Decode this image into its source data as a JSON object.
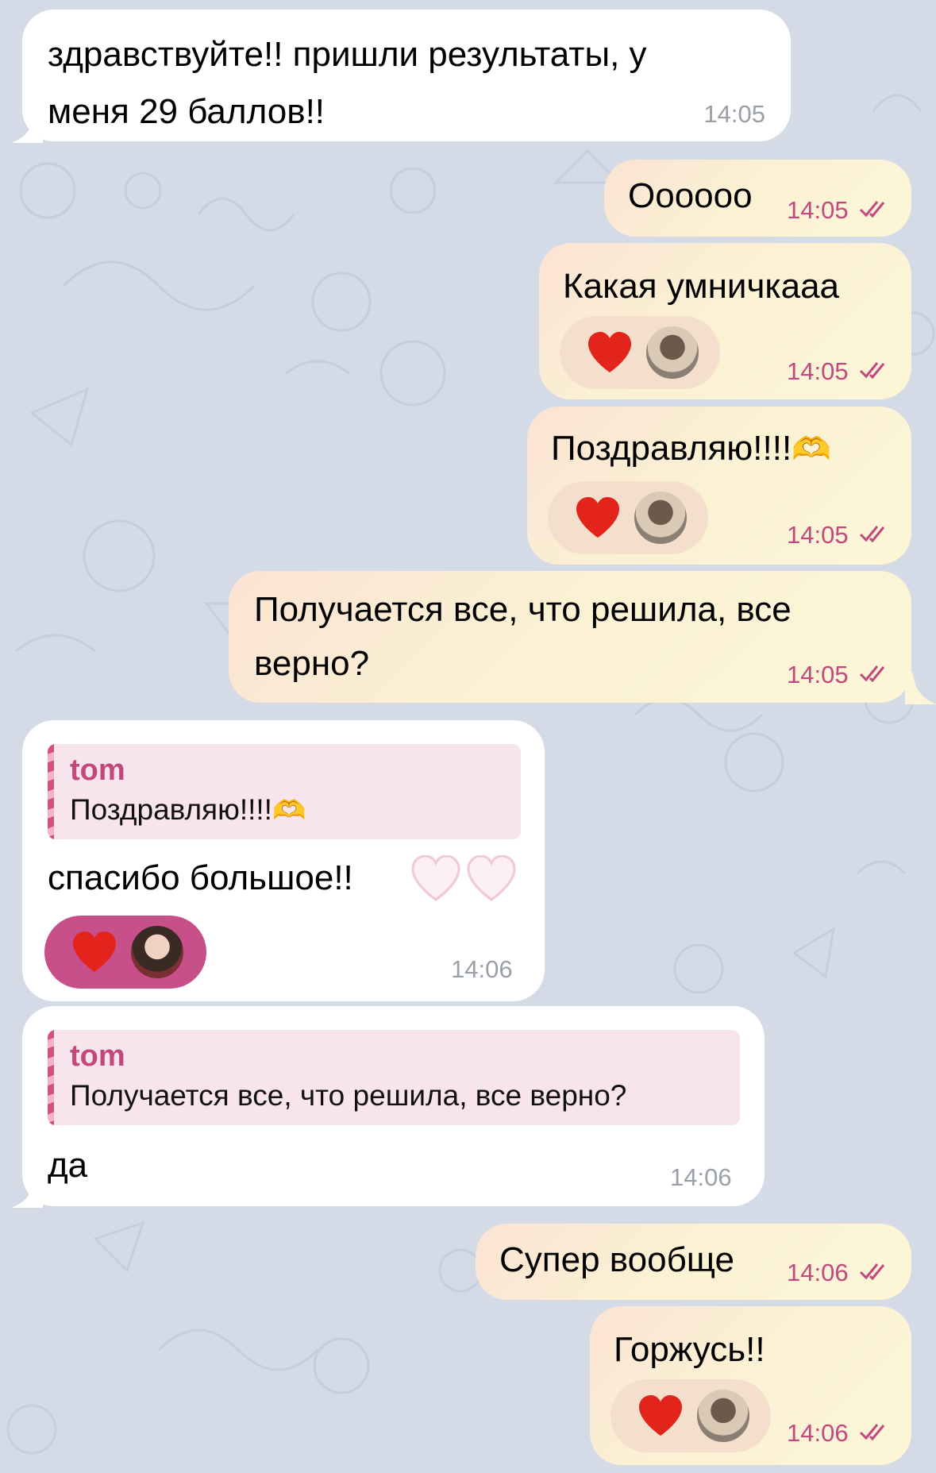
{
  "messages": {
    "m1": {
      "text1": "здравствуйте!! пришли результаты, у",
      "text2": "меня 29 баллов!!",
      "time": "14:05"
    },
    "m2": {
      "text": "Оооооо",
      "time": "14:05"
    },
    "m3": {
      "text": "Какая умничкааа",
      "time": "14:05",
      "reaction": "❤️"
    },
    "m4": {
      "text": "Поздравляю!!!!",
      "emoji": "🫶",
      "time": "14:05",
      "reaction": "❤️"
    },
    "m5": {
      "text1": "Получается все, что решила, все",
      "text2": "верно?",
      "time": "14:05"
    },
    "m6": {
      "reply_name": "tom",
      "reply_text": "Поздравляю!!!!",
      "reply_emoji": "🫶",
      "text": "спасибо большое!!",
      "time": "14:06",
      "reaction": "❤️"
    },
    "m7": {
      "reply_name": "tom",
      "reply_text": "Получается все, что решила, все верно?",
      "text": "да",
      "time": "14:06"
    },
    "m8": {
      "text": "Супер вообще",
      "time": "14:06"
    },
    "m9": {
      "text": "Горжусь!!",
      "time": "14:06",
      "reaction": "❤️"
    }
  },
  "colors": {
    "background": "#d4dbe6",
    "incoming": "#ffffff",
    "outgoing": "#fbf1d4",
    "accent": "#c2487e",
    "reaction_pink": "#c8508a"
  },
  "icons": [
    "double-check-icon",
    "heart-icon",
    "avatar",
    "heart-hands-icon"
  ]
}
